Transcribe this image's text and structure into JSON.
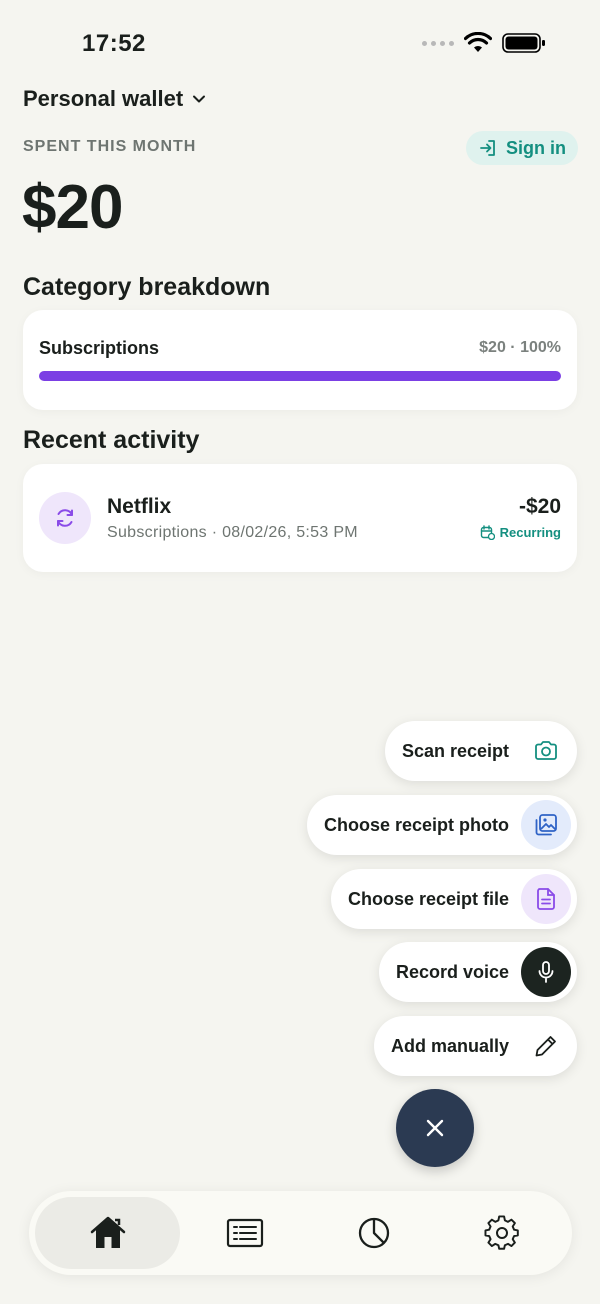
{
  "status_bar": {
    "time": "17:52"
  },
  "header": {
    "wallet_name": "Personal wallet",
    "spent_label": "SPENT THIS MONTH",
    "sign_in": "Sign in",
    "amount": "$20"
  },
  "category_breakdown": {
    "title": "Category breakdown",
    "items": [
      {
        "name": "Subscriptions",
        "meta": "$20 · 100%",
        "share": 1.0,
        "color": "#7b3fe4"
      }
    ]
  },
  "recent_activity": {
    "title": "Recent activity",
    "items": [
      {
        "name": "Netflix",
        "subtitle": "Subscriptions · 08/02/26, 5:53 PM",
        "amount": "-$20",
        "badge": "Recurring",
        "icon": "refresh-icon"
      }
    ]
  },
  "fab_menu": {
    "items": [
      {
        "label": "Scan receipt",
        "icon": "camera-icon"
      },
      {
        "label": "Choose receipt photo",
        "icon": "photo-icon"
      },
      {
        "label": "Choose receipt file",
        "icon": "file-icon"
      },
      {
        "label": "Record voice",
        "icon": "microphone-icon"
      },
      {
        "label": "Add manually",
        "icon": "pencil-icon"
      }
    ],
    "close_icon": "close-icon"
  },
  "bottom_nav": {
    "items": [
      {
        "icon": "home-icon",
        "active": true
      },
      {
        "icon": "list-icon",
        "active": false
      },
      {
        "icon": "pie-chart-icon",
        "active": false
      },
      {
        "icon": "gear-icon",
        "active": false
      }
    ]
  },
  "colors": {
    "accent_teal": "#148f80",
    "category_purple": "#7b3fe4",
    "fab_dark": "#2b3a52"
  }
}
